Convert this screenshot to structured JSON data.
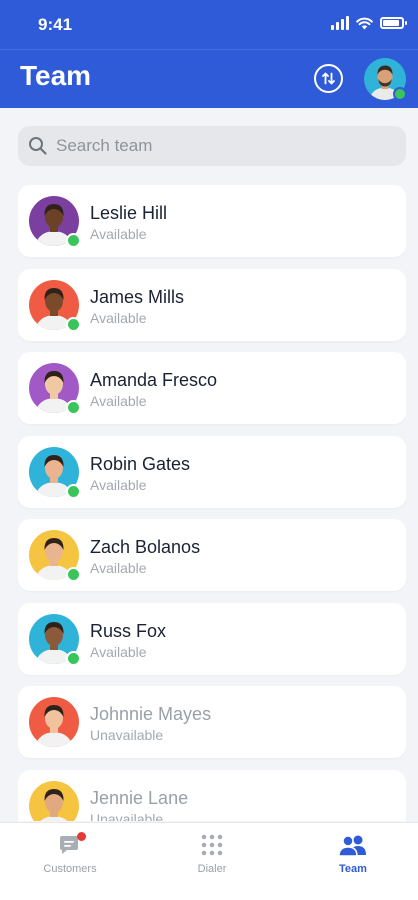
{
  "status_bar": {
    "time": "9:41"
  },
  "header": {
    "title": "Team"
  },
  "search": {
    "placeholder": "Search team"
  },
  "members": [
    {
      "name": "Leslie Hill",
      "status": "Available",
      "available": true,
      "avatar_bg": "#7b3fa0",
      "skin": "#6b4226"
    },
    {
      "name": "James Mills",
      "status": "Available",
      "available": true,
      "avatar_bg": "#ef5b43",
      "skin": "#7a4a2b"
    },
    {
      "name": "Amanda Fresco",
      "status": "Available",
      "available": true,
      "avatar_bg": "#a159c6",
      "skin": "#f0c9a4"
    },
    {
      "name": "Robin Gates",
      "status": "Available",
      "available": true,
      "avatar_bg": "#2fb3d8",
      "skin": "#e9b48e"
    },
    {
      "name": "Zach Bolanos",
      "status": "Available",
      "available": true,
      "avatar_bg": "#f5c542",
      "skin": "#e8b58f"
    },
    {
      "name": "Russ Fox",
      "status": "Available",
      "available": true,
      "avatar_bg": "#2fb3d8",
      "skin": "#8a5a3a"
    },
    {
      "name": "Johnnie Mayes",
      "status": "Unavailable",
      "available": false,
      "avatar_bg": "#ef5b43",
      "skin": "#f0c29e"
    },
    {
      "name": "Jennie Lane",
      "status": "Unavailable",
      "available": false,
      "avatar_bg": "#f5c542",
      "skin": "#e2a880"
    }
  ],
  "tabs": [
    {
      "label": "Customers",
      "icon": "chat-icon",
      "active": false,
      "badge": true
    },
    {
      "label": "Dialer",
      "icon": "keypad-icon",
      "active": false,
      "badge": false
    },
    {
      "label": "Team",
      "icon": "team-icon",
      "active": true,
      "badge": false
    }
  ],
  "colors": {
    "primary": "#2f5bd9",
    "online": "#3ac55c",
    "badge": "#e53935"
  }
}
